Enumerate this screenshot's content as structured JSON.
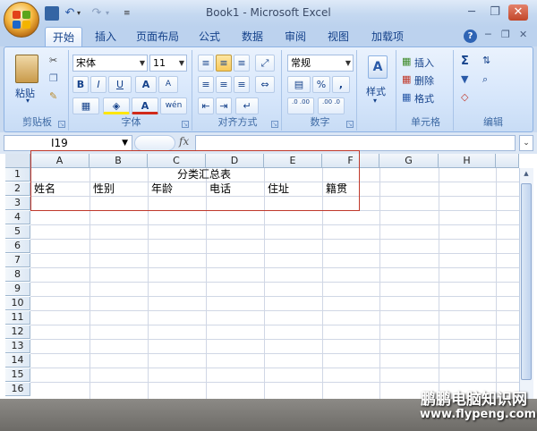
{
  "window": {
    "title": "Book1 - Microsoft Excel",
    "controls": [
      "minimize-icon",
      "restore-icon",
      "close-icon"
    ]
  },
  "ribbon": {
    "tabs": [
      "开始",
      "插入",
      "页面布局",
      "公式",
      "数据",
      "审阅",
      "视图",
      "加载项"
    ],
    "active_tab": "开始",
    "help_icon": "?",
    "clipboard": {
      "paste_label": "粘贴",
      "group_label": "剪贴板"
    },
    "font": {
      "name": "宋体",
      "size": "11",
      "group_label": "字体",
      "bold": "B",
      "italic": "I",
      "underline": "U",
      "grow": "A",
      "shrink": "A",
      "color_letter": "A",
      "phonetic": "wén"
    },
    "alignment": {
      "group_label": "对齐方式"
    },
    "number": {
      "format": "常规",
      "percent": "%",
      "comma": ",",
      "group_label": "数字",
      "inc_dec": ".0 .00",
      "dec_dec": ".00 .0"
    },
    "styles": {
      "label": "样式"
    },
    "cells": {
      "insert": "插入",
      "delete": "删除",
      "format": "格式",
      "group_label": "单元格"
    },
    "editing": {
      "group_label": "编辑"
    },
    "accent_colors": {
      "highlight": "#f8c95a",
      "font_red": "#d12a1a",
      "fill_yellow": "#ffe600"
    }
  },
  "formula_bar": {
    "name_box": "I19",
    "fx": "fx",
    "formula": ""
  },
  "sheet": {
    "columns": [
      "A",
      "B",
      "C",
      "D",
      "E",
      "F",
      "G",
      "H"
    ],
    "rows": [
      "1",
      "2",
      "3",
      "4",
      "5",
      "6",
      "7",
      "8",
      "9",
      "10",
      "11",
      "12",
      "13",
      "14",
      "15",
      "16"
    ],
    "cells": {
      "C1": "分类汇总表",
      "A2": "姓名",
      "B2": "性别",
      "C2": "年龄",
      "D2": "电话",
      "E2": "住址",
      "F2": "籍贯"
    }
  },
  "watermark": {
    "title": "鹏鹏电脑知识网",
    "url": "www.flypeng.com"
  }
}
